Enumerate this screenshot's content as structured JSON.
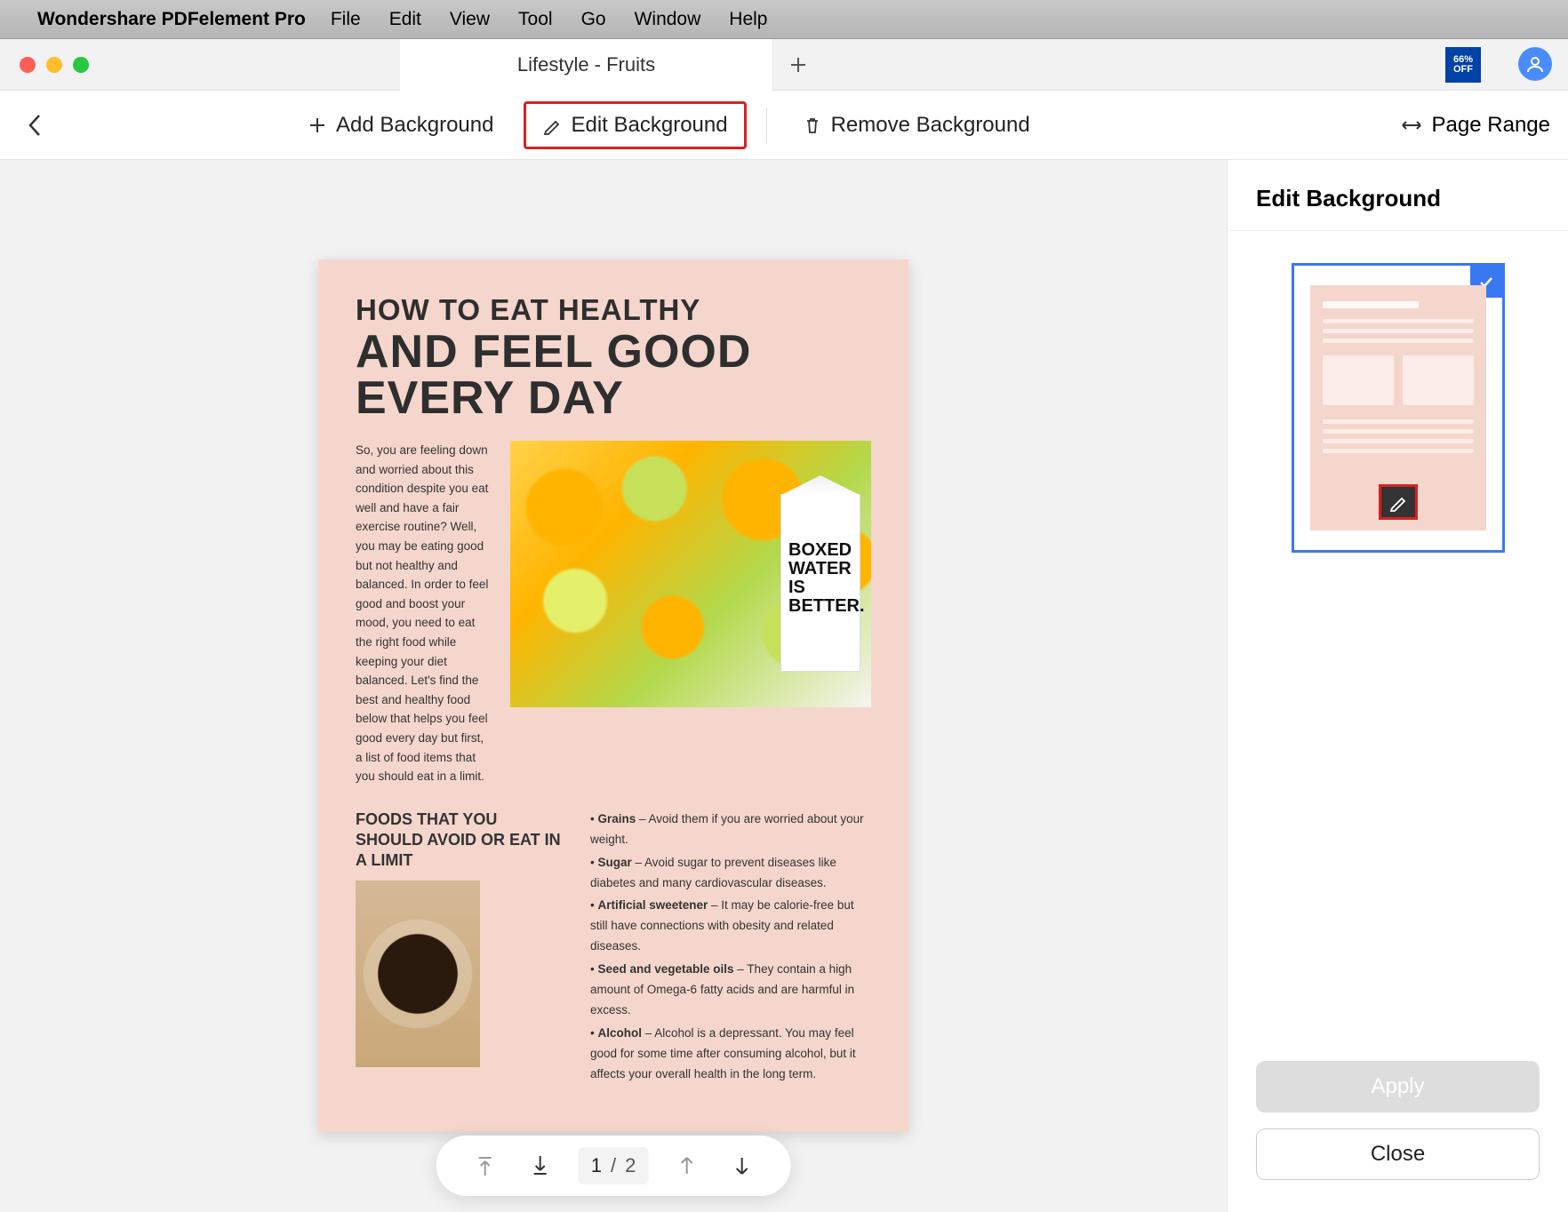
{
  "menubar": {
    "app_name": "Wondershare PDFelement Pro",
    "items": [
      "File",
      "Edit",
      "View",
      "Tool",
      "Go",
      "Window",
      "Help"
    ]
  },
  "tabbar": {
    "active_tab": "Lifestyle - Fruits",
    "promo": {
      "line1": "66%",
      "line2": "OFF"
    }
  },
  "toolbar": {
    "add_bg": "Add Background",
    "edit_bg": "Edit Background",
    "remove_bg": "Remove Background",
    "page_range": "Page Range"
  },
  "document": {
    "h1": "HOW TO EAT HEALTHY",
    "h2": "AND FEEL GOOD EVERY DAY",
    "intro": "So, you are feeling down and worried about this condition despite you eat well and have a fair exercise routine? Well, you may be eating good but not healthy and balanced. In order to feel good and boost your mood, you need to eat the right food while keeping your diet balanced. Let's find the best and healthy food below that helps you feel good every day but first, a list of food items that you should eat in a limit.",
    "carton": "BOXED WATER IS BETTER.",
    "subhead": "FOODS THAT YOU SHOULD AVOID OR EAT IN A LIMIT",
    "bullets": [
      {
        "label": "Grains",
        "text": " – Avoid them if you are worried about your weight."
      },
      {
        "label": "Sugar",
        "text": " – Avoid sugar to prevent diseases like diabetes and many cardiovascular diseases."
      },
      {
        "label": "Artificial sweetener",
        "text": " – It may be calorie-free but still have connections with obesity and related diseases."
      },
      {
        "label": "Seed and vegetable oils",
        "text": " – They contain a high amount of Omega-6 fatty acids and are harmful in excess."
      },
      {
        "label": "Alcohol",
        "text": " – Alcohol is a depressant. You may feel good for some time after consuming alcohol, but it affects your overall health in the long term."
      }
    ]
  },
  "pagenav": {
    "current": "1",
    "sep": "/",
    "total": "2"
  },
  "sidebar": {
    "title": "Edit Background",
    "apply": "Apply",
    "close": "Close"
  }
}
